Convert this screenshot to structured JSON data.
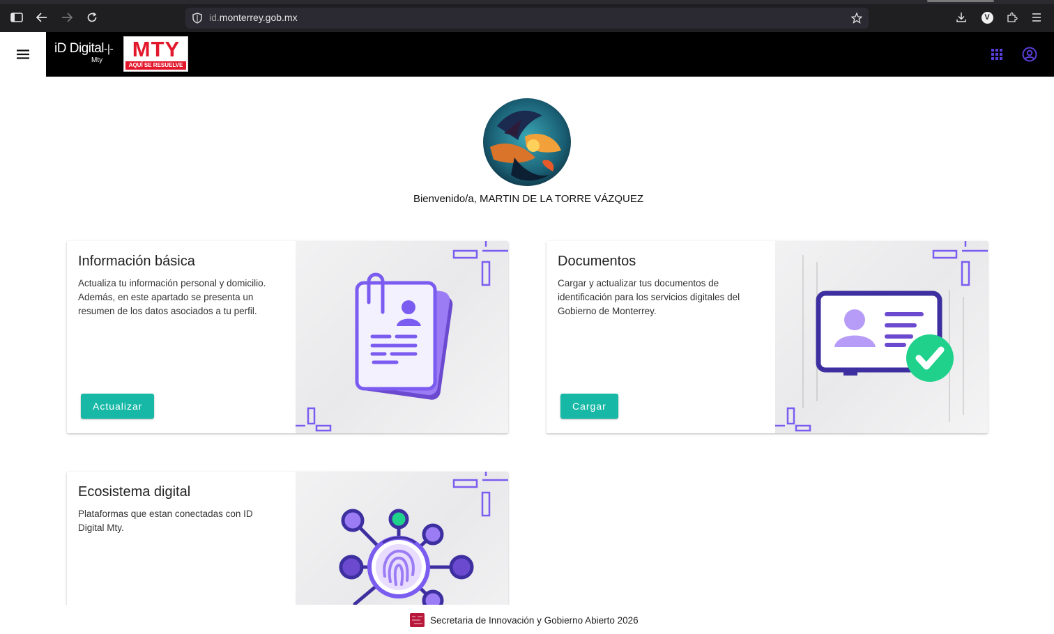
{
  "browser": {
    "url_prefix": "id.",
    "url_host": "monterrey.gob.mx",
    "profile_initial": "V"
  },
  "header": {
    "logo_id": "iD Digital",
    "logo_id_sub": "Mty",
    "logo_mty": "MTY",
    "logo_mty_tagline": "AQUÍ SE RESUELVE",
    "icons": [
      "menu-icon",
      "apps-grid-icon",
      "account-circle-icon"
    ],
    "accent_color": "#5b3fd9"
  },
  "profile": {
    "welcome": "Bienvenido/a, MARTIN DE LA TORRE VÁZQUEZ"
  },
  "cards": [
    {
      "title": "Información básica",
      "description": "Actualiza tu información personal y domicilio. Además, en este apartado se presenta un resumen de los datos asociados a tu perfil.",
      "button": "Actualizar"
    },
    {
      "title": "Documentos",
      "description": "Cargar y actualizar tus documentos de identificación para los servicios digitales del Gobierno de Monterrey.",
      "button": "Cargar"
    },
    {
      "title": "Ecosistema digital",
      "description": "Plataformas que estan conectadas con ID Digital Mty."
    }
  ],
  "colors": {
    "button": "#17b8a6",
    "illustration_purple": "#7b5cf0",
    "illustration_green": "#1fd18b",
    "brand_red": "#e3182d"
  },
  "footer": {
    "text": "Secretaria de Innovación y Gobierno Abierto 2026"
  }
}
